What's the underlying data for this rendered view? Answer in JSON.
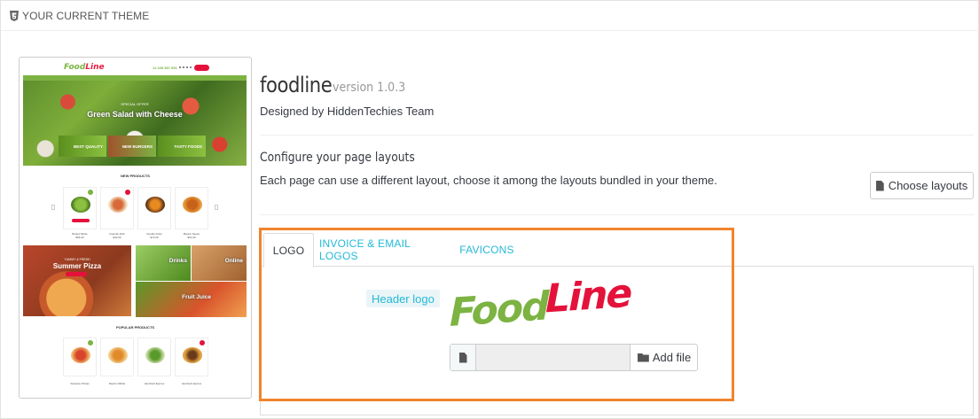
{
  "panel": {
    "title": "YOUR CURRENT THEME",
    "icon": "html5-icon"
  },
  "preview": {
    "logo_part1": "Food",
    "logo_part2": "Line",
    "phone": "12 345 567 891",
    "hero_subtitle": "SPECIAL OFFER",
    "hero_title": "Green Salad with Cheese",
    "banners": [
      "BEST QUALITY",
      "NEW BURGERS",
      "TASTY FOODS"
    ],
    "new_products_title": "NEW PRODUCTS",
    "new_products": [
      "Boiled Sticks",
      "Friendly Dish",
      "Double Drink",
      "Mauris Steam"
    ],
    "prices": [
      "$56.00",
      "$32.00",
      "$72.00",
      "$24.00"
    ],
    "promo_pizza_sub": "YUMMY & FRESH",
    "promo_pizza_title": "Summer Pizza",
    "promo_drinks": "Drinks",
    "promo_online": "Online",
    "promo_juice": "Fruit Juice",
    "popular_title": "POPULAR PRODUCTS",
    "popular_products": [
      "Samples Pizzas",
      "Mauris Nibble",
      "Hendrerit Expres",
      "Hendrerit Expres"
    ]
  },
  "theme": {
    "name": "foodline",
    "version": "version 1.0.3",
    "designed_by": "Designed by HiddenTechies Team"
  },
  "layouts": {
    "title": "Configure your page layouts",
    "description": "Each page can use a different layout, choose it among the layouts bundled in your theme.",
    "button": "Choose layouts"
  },
  "tabs": [
    {
      "label": "LOGO",
      "active": true
    },
    {
      "label": "INVOICE & EMAIL LOGOS",
      "active": false
    },
    {
      "label": "FAVICONS",
      "active": false
    }
  ],
  "logo_tab": {
    "label": "Header logo",
    "logo_text_1": "Food",
    "logo_text_2": "Line",
    "file_value": "",
    "add_file": "Add file"
  },
  "colors": {
    "accent": "#25b9d7",
    "logo_green": "#7cb342",
    "logo_red": "#e4123b",
    "highlight": "#f0842d"
  }
}
